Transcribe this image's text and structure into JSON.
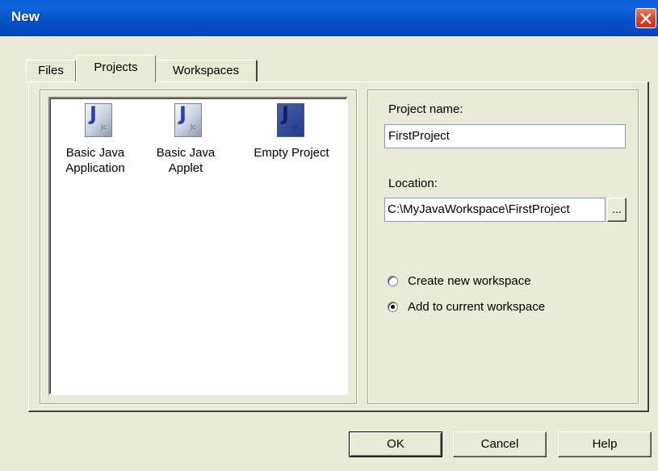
{
  "window": {
    "title": "New"
  },
  "tabs": [
    {
      "label": "Files",
      "active": false
    },
    {
      "label": "Projects",
      "active": true
    },
    {
      "label": "Workspaces",
      "active": false
    }
  ],
  "project_types": [
    {
      "line1": "Basic Java",
      "line2": "Application",
      "icon": "java-project-icon",
      "selected": false
    },
    {
      "line1": "Basic Java",
      "line2": "Applet",
      "icon": "java-project-icon",
      "selected": false
    },
    {
      "line1": "Empty Project",
      "line2": "",
      "icon": "java-project-icon",
      "selected": true
    }
  ],
  "form": {
    "project_name_label": "Project name:",
    "project_name_value": "FirstProject",
    "location_label": "Location:",
    "location_value": "C:\\MyJavaWorkspace\\FirstProject",
    "browse_label": "...",
    "radio_create": "Create new workspace",
    "radio_add": "Add to current workspace",
    "selected_radio": "add"
  },
  "buttons": {
    "ok": "OK",
    "cancel": "Cancel",
    "help": "Help"
  },
  "colors": {
    "title_bar": "#0a5fd6",
    "selection": "#316ac5",
    "dialog_bg": "#ece9d8"
  }
}
